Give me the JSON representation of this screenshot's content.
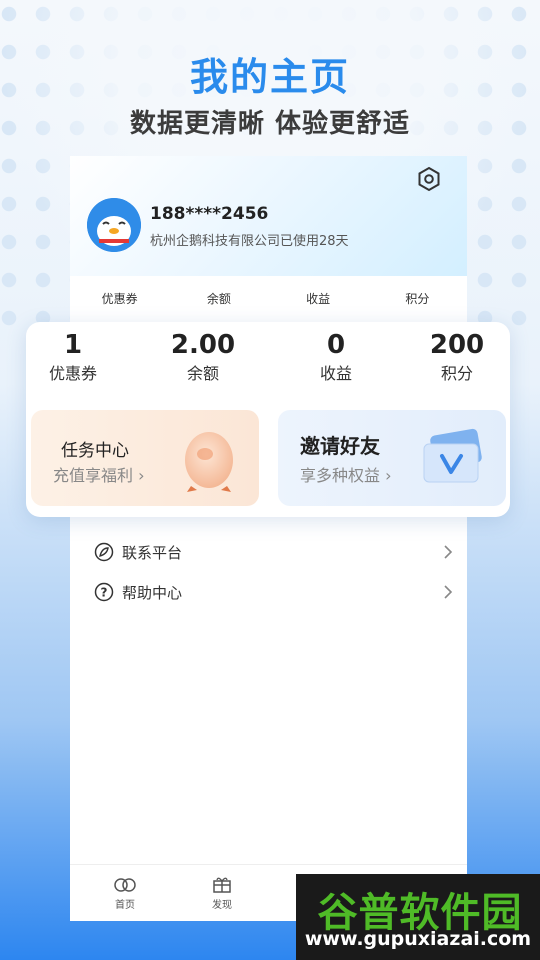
{
  "hero": {
    "title": "我的主页",
    "subtitle": "数据更清晰 体验更舒适"
  },
  "profile": {
    "phone": "188****2456",
    "description": "杭州企鹅科技有限公司已使用28天"
  },
  "mini_stats": [
    "优惠券",
    "余额",
    "收益",
    "积分"
  ],
  "stats": [
    {
      "value": "1",
      "label": "优惠券"
    },
    {
      "value": "2.00",
      "label": "余额"
    },
    {
      "value": "0",
      "label": "收益"
    },
    {
      "value": "200",
      "label": "积分"
    }
  ],
  "tiles": {
    "task": {
      "title": "任务中心",
      "subtitle": "充值享福利 ›"
    },
    "invite": {
      "title": "邀请好友",
      "subtitle": "享多种权益 ›"
    }
  },
  "menu": {
    "partial_label": "…",
    "items": [
      {
        "label": "联系平台",
        "icon": "leaf-icon"
      },
      {
        "label": "帮助中心",
        "icon": "question-icon"
      }
    ]
  },
  "tabbar": {
    "home": "首页",
    "discover": "发现"
  },
  "watermark": {
    "title": "谷普软件园",
    "url": "www.gupuxiazai.com"
  },
  "colors": {
    "accent": "#2a8bec",
    "watermark_green": "#4fbb27"
  }
}
